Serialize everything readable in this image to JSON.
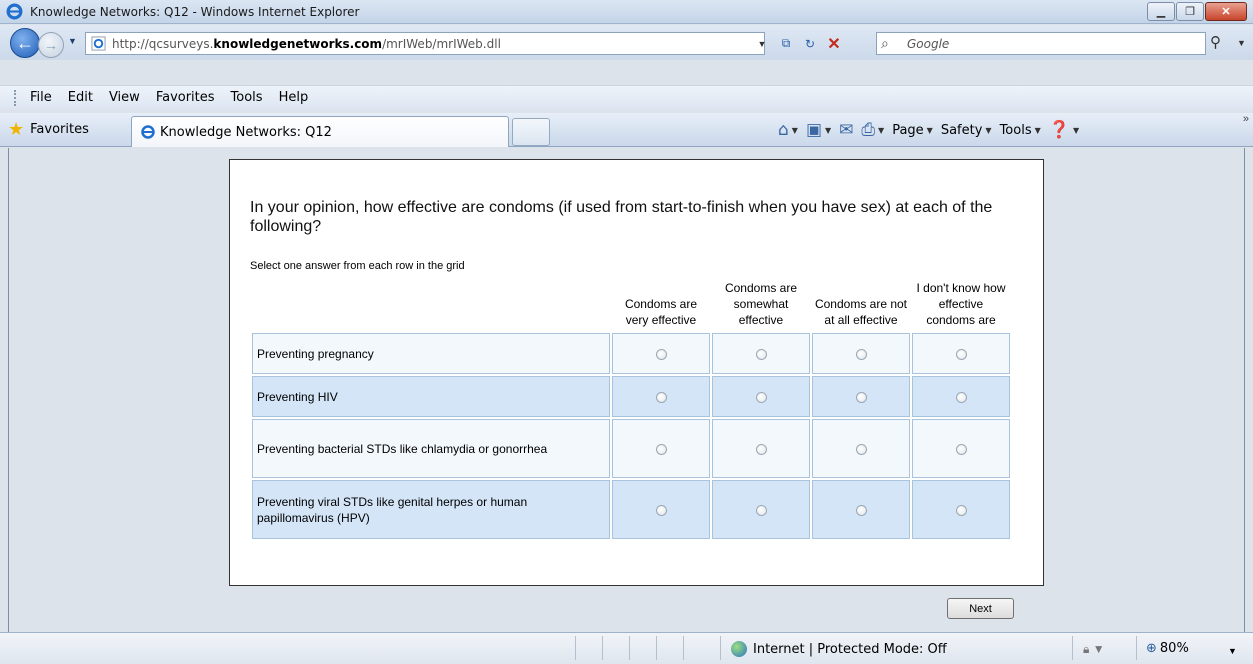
{
  "window": {
    "title": "Knowledge Networks: Q12 - Windows Internet Explorer"
  },
  "address": {
    "url_prefix": "http://qcsurveys.",
    "url_domain": "knowledgenetworks.com",
    "url_path": "/mrIWeb/mrIWeb.dll",
    "search_placeholder": "Google"
  },
  "menu": [
    "File",
    "Edit",
    "View",
    "Favorites",
    "Tools",
    "Help"
  ],
  "tabs": {
    "favorites_label": "Favorites",
    "active_tab_label": "Knowledge Networks: Q12",
    "commands": {
      "page": "Page",
      "safety": "Safety",
      "tools": "Tools"
    }
  },
  "survey": {
    "question": "In your opinion, how effective are condoms (if used from start-to-finish when you have sex) at each of the following?",
    "instruction": "Select one answer from each row in the grid",
    "columns": [
      "Condoms are very effective",
      "Condoms are somewhat effective",
      "Condoms are not at all effective",
      "I don't know how effective condoms are"
    ],
    "rows": [
      "Preventing pregnancy",
      "Preventing HIV",
      "Preventing bacterial STDs like chlamydia or gonorrhea",
      "Preventing viral STDs like genital herpes or human papillomavirus (HPV)"
    ],
    "next_label": "Next"
  },
  "status": {
    "zone": "Internet | Protected Mode: Off",
    "zoom": "80%"
  }
}
